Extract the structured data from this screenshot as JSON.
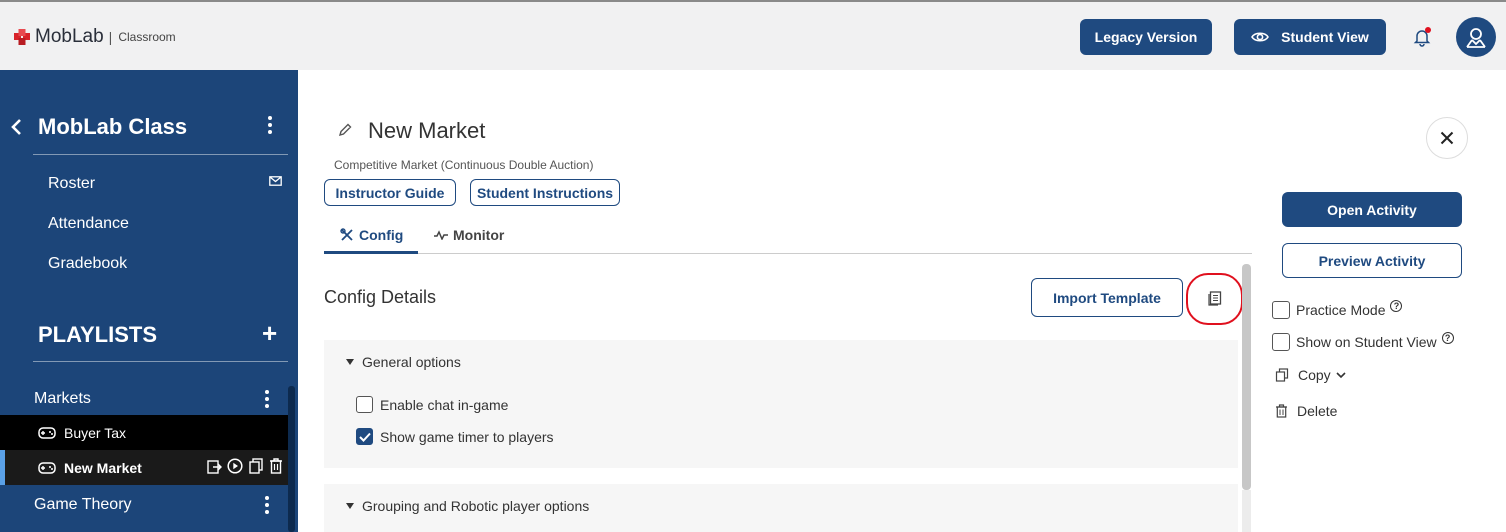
{
  "header": {
    "brand": "MobLab",
    "separator": "|",
    "product": "Classroom",
    "legacy_label": "Legacy Version",
    "student_view_label": "Student View"
  },
  "sidebar": {
    "class_title": "MobLab Class",
    "items": [
      {
        "label": "Roster"
      },
      {
        "label": "Attendance"
      },
      {
        "label": "Gradebook"
      }
    ],
    "playlists_heading": "PLAYLISTS",
    "groups": [
      {
        "label": "Markets",
        "games": [
          "Buyer Tax",
          "New Market"
        ]
      },
      {
        "label": "Game Theory"
      }
    ]
  },
  "activity": {
    "title": "New Market",
    "subtitle": "Competitive Market (Continuous Double Auction)",
    "instructor_guide": "Instructor Guide",
    "student_instructions": "Student Instructions",
    "tabs": [
      {
        "label": "Config",
        "active": true
      },
      {
        "label": "Monitor",
        "active": false
      }
    ],
    "config_title": "Config Details",
    "import_template": "Import Template",
    "sections": [
      {
        "title": "General options",
        "options": [
          {
            "label": "Enable chat in-game",
            "checked": false
          },
          {
            "label": "Show game timer to players",
            "checked": true
          }
        ]
      },
      {
        "title": "Grouping and Robotic player options"
      }
    ]
  },
  "right_panel": {
    "open_activity": "Open Activity",
    "preview_activity": "Preview Activity",
    "practice_mode": "Practice Mode",
    "show_on_student_view": "Show on Student View",
    "copy": "Copy",
    "delete": "Delete"
  },
  "colors": {
    "primary": "#1f4a80",
    "sidebar": "#1c4579",
    "highlight_ring": "#e0101e",
    "notification_dot": "#e0101e",
    "logo": "#d8232a"
  },
  "icons": [
    "moblab-logo-icon",
    "eye-icon",
    "bell-icon",
    "user-icon",
    "chevron-left-icon",
    "kebab-icon",
    "mail-icon",
    "plus-icon",
    "gamepad-icon",
    "share-icon",
    "play-icon",
    "copy-icon",
    "trash-icon",
    "pencil-icon",
    "tools-icon",
    "pulse-icon",
    "document-icon",
    "close-icon",
    "help-icon",
    "chevron-down-icon"
  ]
}
